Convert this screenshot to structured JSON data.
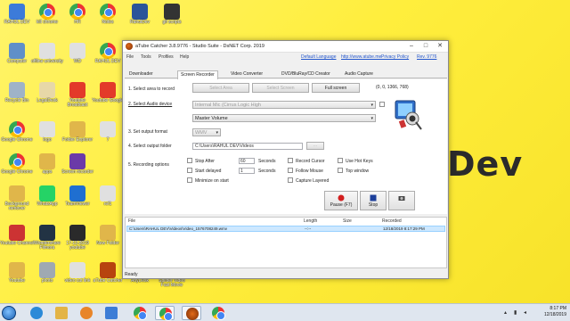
{
  "desktop": {
    "watermark": "Dev",
    "icons": [
      {
        "label": "RAHUL DEV",
        "col": 0,
        "row": 0,
        "color": "#3c7bd9",
        "icon": "folder-user-icon"
      },
      {
        "label": "kill chrome",
        "col": 1,
        "row": 0,
        "color": "chrome",
        "icon": "chrome-icon"
      },
      {
        "label": "HR",
        "col": 2,
        "row": 0,
        "color": "chrome",
        "icon": "chrome-icon"
      },
      {
        "label": "Notes",
        "col": 3,
        "row": 0,
        "color": "chrome",
        "icon": "chrome-icon"
      },
      {
        "label": "RahulDev",
        "col": 4,
        "row": 0,
        "color": "#2a5599",
        "icon": "word-doc-icon"
      },
      {
        "label": "gif scripts",
        "col": 5,
        "row": 0,
        "color": "#333333",
        "icon": "script-icon"
      },
      {
        "label": "Computer",
        "col": 0,
        "row": 1,
        "color": "#5f8fc9",
        "icon": "computer-icon"
      },
      {
        "label": "offline university",
        "col": 1,
        "row": 1,
        "color": "#e0e0e0",
        "icon": "document-icon"
      },
      {
        "label": "WD",
        "col": 2,
        "row": 1,
        "color": "#e0e0e0",
        "icon": "document-icon"
      },
      {
        "label": "RAHUL DEV",
        "col": 3,
        "row": 1,
        "color": "chrome",
        "icon": "chrome-icon"
      },
      {
        "label": "Recycle Bin",
        "col": 0,
        "row": 2,
        "color": "#9fb3c8",
        "icon": "recycle-bin-icon"
      },
      {
        "label": "LegalDesk",
        "col": 1,
        "row": 2,
        "color": "#e7d8a8",
        "icon": "document-icon"
      },
      {
        "label": "Youtube Broadcast",
        "col": 2,
        "row": 2,
        "color": "#e33a2a",
        "icon": "youtube-icon"
      },
      {
        "label": "Youtube Google",
        "col": 3,
        "row": 2,
        "color": "#e33a2a",
        "icon": "youtube-icon"
      },
      {
        "label": "Google Chrome",
        "col": 0,
        "row": 3,
        "color": "chrome",
        "icon": "chrome-icon"
      },
      {
        "label": "logo",
        "col": 1,
        "row": 3,
        "color": "#e0e0e0",
        "icon": "image-icon"
      },
      {
        "label": "Folder Explorer",
        "col": 2,
        "row": 3,
        "color": "#e0b64a",
        "icon": "folder-icon"
      },
      {
        "label": "7",
        "col": 3,
        "row": 3,
        "color": "#e0e0e0",
        "icon": "document-icon"
      },
      {
        "label": "Google Chrome",
        "col": 0,
        "row": 4,
        "color": "chrome",
        "icon": "chrome-icon"
      },
      {
        "label": "apps",
        "col": 1,
        "row": 4,
        "color": "#e0b64a",
        "icon": "folder-icon"
      },
      {
        "label": "Screen recorder",
        "col": 2,
        "row": 4,
        "color": "#6b3aa8",
        "icon": "app-icon"
      },
      {
        "label": "Background remover",
        "col": 0,
        "row": 5,
        "color": "#e0b64a",
        "icon": "folder-icon"
      },
      {
        "label": "WhatsApp",
        "col": 1,
        "row": 5,
        "color": "#25d366",
        "icon": "whatsapp-icon"
      },
      {
        "label": "TeamViewer",
        "col": 2,
        "row": 5,
        "color": "#1f6fd1",
        "icon": "teamviewer-icon"
      },
      {
        "label": "ref1",
        "col": 3,
        "row": 5,
        "color": "#e0e0e0",
        "icon": "document-icon"
      },
      {
        "label": "Youtube Channel",
        "col": 0,
        "row": 6,
        "color": "#c33",
        "icon": "youtube-icon"
      },
      {
        "label": "Wondershare Filmora",
        "col": 1,
        "row": 6,
        "color": "#234",
        "icon": "app-icon"
      },
      {
        "label": "17-12-2019 youtube",
        "col": 2,
        "row": 6,
        "color": "#2a2a2a",
        "icon": "video-icon"
      },
      {
        "label": "New Folder",
        "col": 3,
        "row": 6,
        "color": "#e0b64a",
        "icon": "folder-icon"
      },
      {
        "label": "Youtube",
        "col": 0,
        "row": 7,
        "color": "#e0b64a",
        "icon": "folder-icon"
      },
      {
        "label": "photo",
        "col": 1,
        "row": 7,
        "color": "#9fa9b2",
        "icon": "image-icon"
      },
      {
        "label": "video cut link",
        "col": 2,
        "row": 7,
        "color": "#e0e0e0",
        "icon": "document-icon"
      },
      {
        "label": "aTube Catcher",
        "col": 3,
        "row": 7,
        "color": "#b7440f",
        "icon": "atube-icon"
      },
      {
        "label": "AnyDesk",
        "col": 4,
        "row": 7,
        "color": "#e63b1f",
        "icon": "anydesk-icon"
      },
      {
        "label": "Splitter Video Fast Movie",
        "col": 5,
        "row": 7,
        "color": "#2a2a2a",
        "icon": "app-icon"
      }
    ]
  },
  "window": {
    "title": "aTube Catcher 3.8.9776 - Studio Suite - DsNET Corp. 2019",
    "controls": {
      "minimize": "–",
      "maximize": "□",
      "close": "✕"
    },
    "menu": [
      "File",
      "Tools",
      "Profiles",
      "Help"
    ],
    "links": [
      "Default Language",
      "http://www.atube.me",
      "Privacy Policy",
      "Rev. 9776"
    ],
    "tabs": [
      "Downloader",
      "Screen Recorder",
      "Video Converter",
      "DVD/BluRay/CD Creator",
      "Audio Capture"
    ],
    "active_tab": 1,
    "steps": {
      "s1": "1. Select area to record",
      "s2": "2. Select Audio device",
      "s3": "3. Set output format",
      "s4": "4. Select output folder",
      "s5": "5. Recording options"
    },
    "area_buttons": [
      "Select Area",
      "Select Screen",
      "Full screen"
    ],
    "coords": "(0, 0, 1366, 768)",
    "audio_device": "Internal Mic (Cirrus Logic High",
    "audio_mix": "Master Volume",
    "format": "WMV",
    "output_folder": "C:\\Users\\RAHUL DEV\\Videos",
    "browse_label": "...",
    "options": {
      "stop_after": "Stop After",
      "stop_after_value": "60",
      "seconds": "Seconds",
      "start_delayed": "Start delayed",
      "start_delayed_value": "1",
      "seconds2": "Seconds",
      "minimize": "Minimize on start",
      "record_cursor": "Record Cursor",
      "follow_mouse": "Follow Mouse",
      "capture_layered": "Capture Layered",
      "hot_keys": "Use Hot Keys",
      "top_window": "Top window"
    },
    "record_buttons": [
      "Pause (F7)",
      "Stop",
      ""
    ],
    "list": {
      "headers": [
        "File",
        "Length",
        "Size",
        "Recorded"
      ],
      "rows": [
        {
          "file": "C:\\Users\\RAHUL DEV\\Videos\\Video_1576708249.wmv",
          "length": "--:--",
          "size": "",
          "recorded": "12/18/2019 8:17:29 PM"
        }
      ]
    },
    "status": "Ready"
  },
  "taskbar": {
    "apps": [
      "ie-icon",
      "explorer-icon",
      "media-icon",
      "chrome-icon",
      "chrome-active-icon",
      "atube-icon",
      "chrome-icon"
    ],
    "time": "8:17 PM",
    "date": "12/18/2019"
  }
}
